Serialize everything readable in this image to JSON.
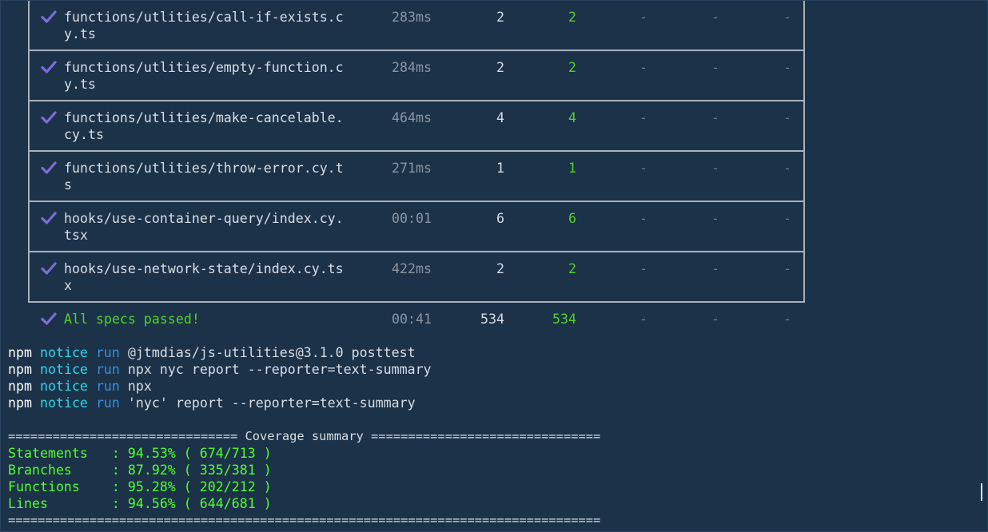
{
  "spec_rows": [
    {
      "spec_line1": "functions/utlities/call-if-exists.c",
      "spec_line2": "y.ts",
      "duration": "283ms",
      "tests": "2",
      "passing": "2",
      "failing": "-",
      "pending": "-",
      "skipped": "-"
    },
    {
      "spec_line1": "functions/utlities/empty-function.c",
      "spec_line2": "y.ts",
      "duration": "284ms",
      "tests": "2",
      "passing": "2",
      "failing": "-",
      "pending": "-",
      "skipped": "-"
    },
    {
      "spec_line1": "functions/utlities/make-cancelable.",
      "spec_line2": "cy.ts",
      "duration": "464ms",
      "tests": "4",
      "passing": "4",
      "failing": "-",
      "pending": "-",
      "skipped": "-"
    },
    {
      "spec_line1": "functions/utlities/throw-error.cy.t",
      "spec_line2": "s",
      "duration": "271ms",
      "tests": "1",
      "passing": "1",
      "failing": "-",
      "pending": "-",
      "skipped": "-"
    },
    {
      "spec_line1": "hooks/use-container-query/index.cy.",
      "spec_line2": "tsx",
      "duration": "00:01",
      "tests": "6",
      "passing": "6",
      "failing": "-",
      "pending": "-",
      "skipped": "-"
    },
    {
      "spec_line1": "hooks/use-network-state/index.cy.ts",
      "spec_line2": "x",
      "duration": "422ms",
      "tests": "2",
      "passing": "2",
      "failing": "-",
      "pending": "-",
      "skipped": "-"
    }
  ],
  "summary_row": {
    "label": "All specs passed!",
    "duration": "00:41",
    "tests": "534",
    "passing": "534",
    "failing": "-",
    "pending": "-",
    "skipped": "-"
  },
  "npm_lines": [
    {
      "npm": "npm",
      "notice": "notice",
      "run": "run",
      "rest": "@jtmdias/js-utilities@3.1.0 posttest"
    },
    {
      "npm": "npm",
      "notice": "notice",
      "run": "run",
      "rest": "npx nyc report --reporter=text-summary"
    },
    {
      "npm": "npm",
      "notice": "notice",
      "run": "run",
      "rest": "npx"
    },
    {
      "npm": "npm",
      "notice": "notice",
      "run": "run",
      "rest": "'nyc' report --reporter=text-summary"
    }
  ],
  "coverage": {
    "header": "=============================== Coverage summary ===============================",
    "rows": [
      {
        "label": "Statements   : ",
        "value": "94.53% ( 674/713 )"
      },
      {
        "label": "Branches     : ",
        "value": "87.92% ( 335/381 )"
      },
      {
        "label": "Functions    : ",
        "value": "95.28% ( 202/212 )"
      },
      {
        "label": "Lines        : ",
        "value": "94.56% ( 644/681 )"
      }
    ],
    "footer": "================================================================================"
  },
  "colors": {
    "background": "#1b3249",
    "check": "#7b6fd8",
    "green": "#54d327",
    "cyan": "#2fd7ea",
    "blue": "#3a8ee0",
    "table_border": "#a9b1ba"
  },
  "icons": {
    "check": "checkmark-icon"
  }
}
